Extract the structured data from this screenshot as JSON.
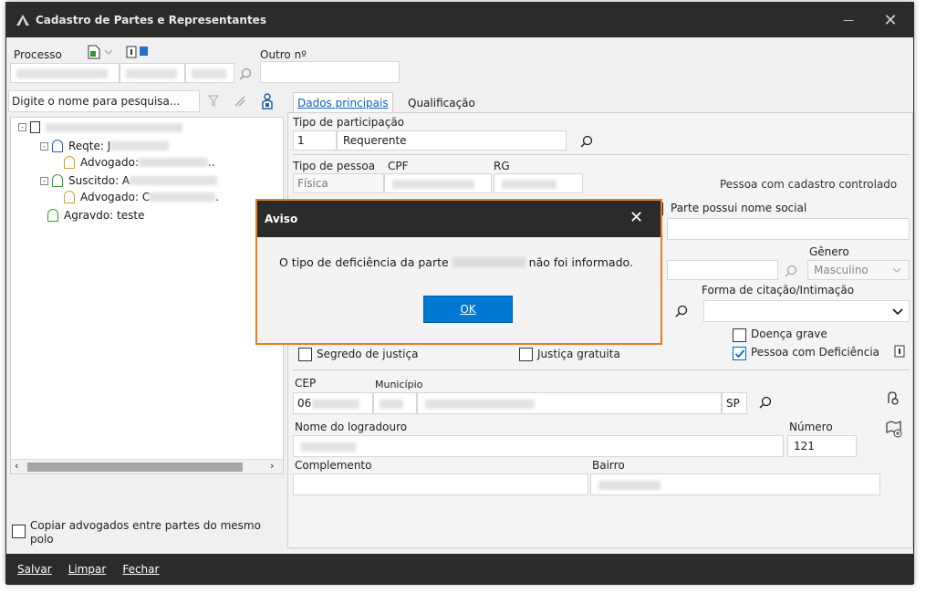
{
  "window": {
    "title": "Cadastro de Partes e Representantes",
    "minimize": "—",
    "close": "✕"
  },
  "top": {
    "processo_label": "Processo",
    "outro_label": "Outro nº",
    "outro_value": ""
  },
  "search": {
    "placeholder": "Digite o nome para pesquisa..."
  },
  "tree": {
    "nodes": [
      {
        "label": "Reqte: J"
      },
      {
        "label": "Advogado: "
      },
      {
        "label": "Suscitdo: A"
      },
      {
        "label": "Advogado: C"
      },
      {
        "label": "Agravdo: teste"
      }
    ],
    "trunc1": "..",
    "trunc2": "."
  },
  "copy_checkbox": {
    "line1": "Copiar advogados entre partes do mesmo",
    "line2": "polo"
  },
  "tabs": [
    {
      "label": "Dados principais"
    },
    {
      "label": "Qualificação"
    }
  ],
  "form": {
    "tipo_participacao_label": "Tipo de participação",
    "tipo_code": "1",
    "tipo_value": "Requerente",
    "tipo_pessoa_label": "Tipo de pessoa",
    "cpf_label": "CPF",
    "rg_label": "RG",
    "tipo_pessoa_value": "Física",
    "controlled_text": "Pessoa com cadastro controlado",
    "nome_social_label": "Parte possui nome social",
    "genero_label": "Gênero",
    "genero_value": "Masculino",
    "forma_citacao_label": "Forma de citação/Intimação",
    "doenca_grave": "Doença grave",
    "pcd_label": "Pessoa com Deficiência",
    "segredo": "Segredo de justiça",
    "justica_gratuita": "Justiça gratuita",
    "cep_label": "CEP",
    "cep_value": "06",
    "municipio_label": "Município",
    "uf_value": "SP",
    "logradouro_label": "Nome do logradouro",
    "numero_label": "Número",
    "numero_value": "121",
    "complemento_label": "Complemento",
    "bairro_label": "Bairro"
  },
  "dialog": {
    "title": "Aviso",
    "message_before": "O tipo de deficiência da parte",
    "message_after": "não foi informado.",
    "ok_label": "OK"
  },
  "bottom": {
    "salvar": "Salvar",
    "limpar": "Limpar",
    "fechar": "Fechar"
  },
  "colors": {
    "accent": "#0078d4",
    "dialog_border": "#e2801c",
    "titlebar": "#2b2b2b",
    "person_icon_blue": "#1f5fb5",
    "person_icon_green": "#2e9a2e",
    "person_icon_orange": "#e29a1f"
  },
  "icons": [
    "app-logo-icon",
    "new-doc-icon",
    "info-icon",
    "search-icon",
    "filter-icon",
    "clear-icon",
    "person-icon",
    "tree-expand-icon",
    "document-icon",
    "chevron-down-icon",
    "map-icon",
    "location-icon",
    "close-icon"
  ]
}
